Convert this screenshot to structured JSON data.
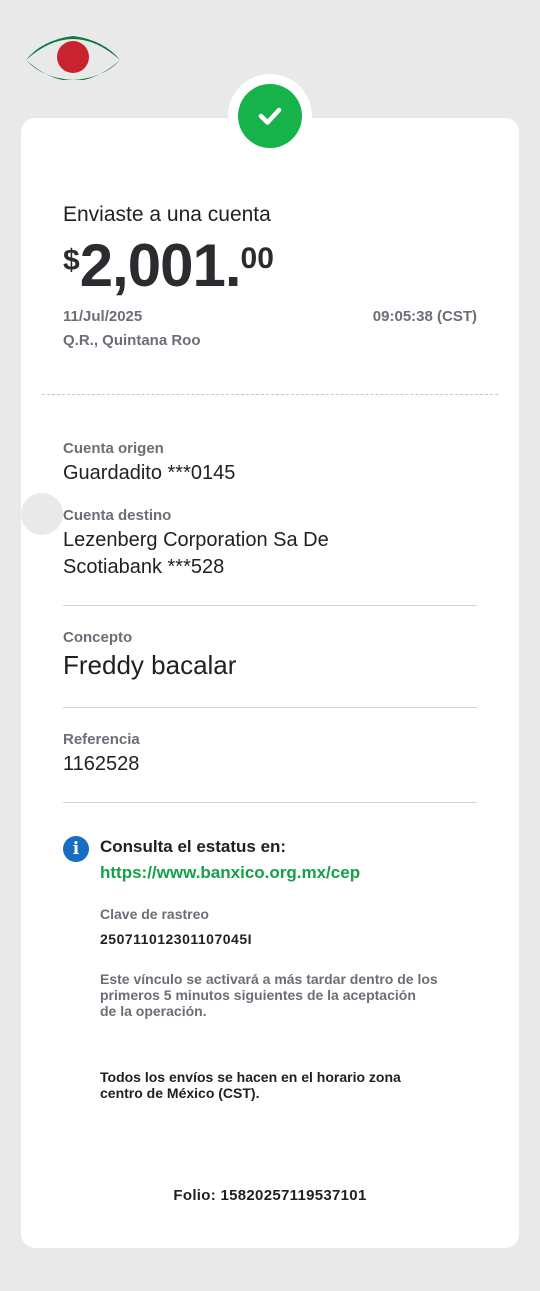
{
  "brand": {
    "logo_icon": "bank-logo-icon",
    "colors": {
      "green": "#0a7a3e",
      "red": "#c8242f",
      "success": "#15b34a",
      "link": "#15a04a",
      "info": "#1a6ec1"
    }
  },
  "status": {
    "icon": "check-icon"
  },
  "transfer": {
    "title": "Enviaste a una cuenta",
    "currency": "$",
    "amount_main": "2,001.",
    "amount_cents": "00",
    "date": "11/Jul/2025",
    "time": "09:05:38 (CST)",
    "location": "Q.R., Quintana Roo"
  },
  "details": {
    "origin_label": "Cuenta origen",
    "origin_value": "Guardadito ***0145",
    "dest_label": "Cuenta destino",
    "dest_name": "Lezenberg Corporation Sa De",
    "dest_bank": "Scotiabank ***528",
    "concept_label": "Concepto",
    "concept_value": "Freddy bacalar",
    "reference_label": "Referencia",
    "reference_value": "1162528"
  },
  "status_info": {
    "icon": "info-icon",
    "title": "Consulta el estatus en:",
    "link": "https://www.banxico.org.mx/cep",
    "tracking_label": "Clave de rastreo",
    "tracking_value": "250711012301107045I",
    "note_line1": "Este vínculo se activará a más tardar dentro de los",
    "note_line2": "primeros 5 minutos siguientes de la aceptación",
    "note_line3": "de la operación.",
    "tz_line1": "Todos los envíos se hacen en el horario zona",
    "tz_line2": "centro de México (CST)."
  },
  "footer": {
    "folio": "Folio: 15820257119537101"
  }
}
